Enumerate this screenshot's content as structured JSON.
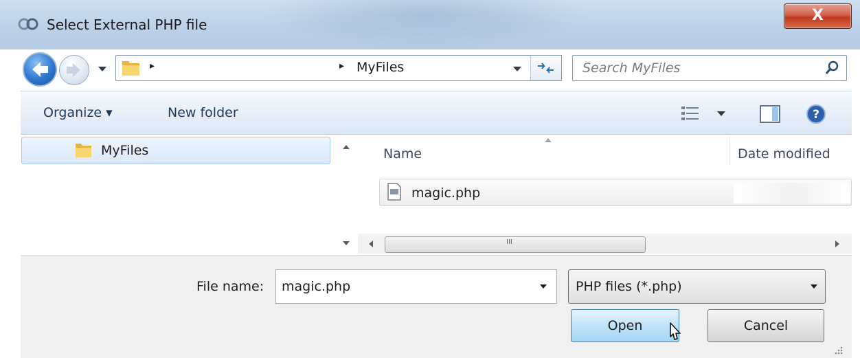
{
  "window": {
    "title": "Select External PHP file",
    "close_label": "X"
  },
  "address": {
    "path_separator": "▸",
    "current_folder": "MyFiles",
    "search_placeholder": "Search MyFiles"
  },
  "toolbar": {
    "organize_label": "Organize ▾",
    "new_folder_label": "New folder"
  },
  "nav_pane": {
    "items": [
      {
        "label": "MyFiles",
        "icon": "folder-icon",
        "selected": true
      }
    ]
  },
  "file_list": {
    "columns": [
      "Name",
      "Date modified"
    ],
    "rows": [
      {
        "name": "magic.php",
        "icon": "php-file-icon"
      }
    ],
    "scroll_glyph": "III"
  },
  "bottom": {
    "filename_label": "File name:",
    "filename_value": "magic.php",
    "filetype_value": "PHP files (*.php)",
    "open_label": "Open",
    "cancel_label": "Cancel"
  },
  "colors": {
    "accent": "#3c7fb1",
    "close": "#c0391c",
    "toolbar": "#e8eff8"
  }
}
